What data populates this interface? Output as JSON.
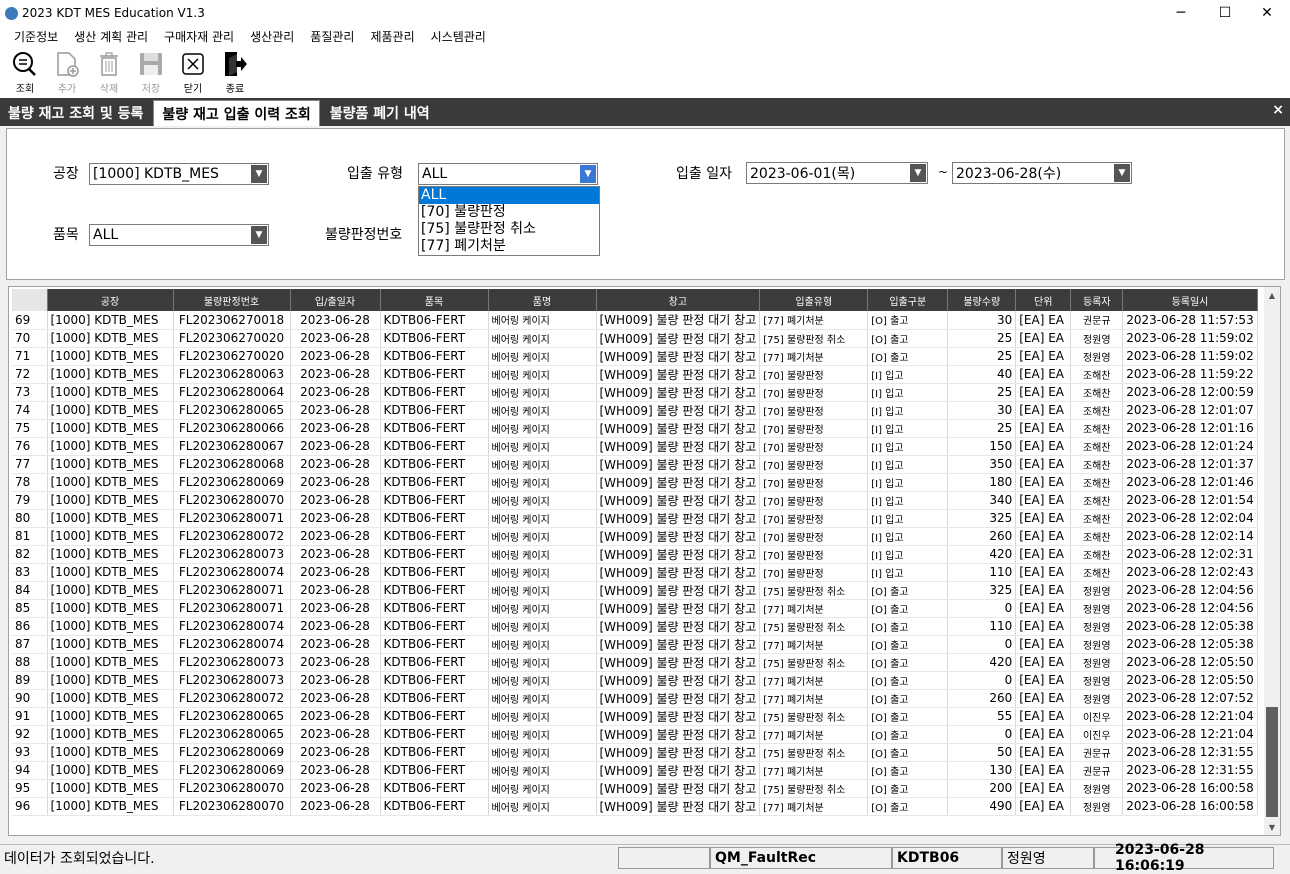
{
  "window": {
    "title": "2023 KDT MES Education V1.3",
    "minimize": "─",
    "maximize": "☐",
    "close": "✕"
  },
  "menu": [
    "기준정보",
    "생산 계획 관리",
    "구매자재 관리",
    "생산관리",
    "품질관리",
    "제품관리",
    "시스템관리"
  ],
  "toolbar": {
    "search": "조회",
    "add": "추가",
    "delete": "삭제",
    "save": "저장",
    "close": "닫기",
    "exit": "종료"
  },
  "tabs": [
    "불량 재고 조회 및 등록",
    "불량 재고 입출 이력 조회",
    "불량품 폐기 내역"
  ],
  "tab_close": "×",
  "filter": {
    "plant_label": "공장",
    "plant_value": "[1000] KDTB_MES",
    "type_label": "입출 유형",
    "type_value": "ALL",
    "date_label": "입출 일자",
    "date_from": "2023-06-01(목)",
    "date_sep": "~",
    "date_to": "2023-06-28(수)",
    "item_label": "품목",
    "item_value": "ALL",
    "judge_label": "불량판정번호",
    "dropdown_options": [
      "ALL",
      "[70] 불량판정",
      "[75] 불량판정 취소",
      "[77] 폐기처분"
    ]
  },
  "grid": {
    "columns": [
      "공장",
      "불량판정번호",
      "입/출일자",
      "품목",
      "품명",
      "창고",
      "입출유형",
      "입출구분",
      "불량수량",
      "단위",
      "등록자",
      "등록일시"
    ],
    "rows": [
      [
        "69",
        "[1000] KDTB_MES",
        "FL202306270018",
        "2023-06-28",
        "KDTB06-FERT",
        "베어링 케이지",
        "[WH009] 불량 판정 대기 창고",
        "[77] 폐기처분",
        "[O] 출고",
        "30",
        "[EA] EA",
        "권문규",
        "2023-06-28 11:57:53"
      ],
      [
        "70",
        "[1000] KDTB_MES",
        "FL202306270020",
        "2023-06-28",
        "KDTB06-FERT",
        "베어링 케이지",
        "[WH009] 불량 판정 대기 창고",
        "[75] 불량판정 취소",
        "[O] 출고",
        "25",
        "[EA] EA",
        "정원영",
        "2023-06-28 11:59:02"
      ],
      [
        "71",
        "[1000] KDTB_MES",
        "FL202306270020",
        "2023-06-28",
        "KDTB06-FERT",
        "베어링 케이지",
        "[WH009] 불량 판정 대기 창고",
        "[77] 폐기처분",
        "[O] 출고",
        "25",
        "[EA] EA",
        "정원영",
        "2023-06-28 11:59:02"
      ],
      [
        "72",
        "[1000] KDTB_MES",
        "FL202306280063",
        "2023-06-28",
        "KDTB06-FERT",
        "베어링 케이지",
        "[WH009] 불량 판정 대기 창고",
        "[70] 불량판정",
        "[I] 입고",
        "40",
        "[EA] EA",
        "조해찬",
        "2023-06-28 11:59:22"
      ],
      [
        "73",
        "[1000] KDTB_MES",
        "FL202306280064",
        "2023-06-28",
        "KDTB06-FERT",
        "베어링 케이지",
        "[WH009] 불량 판정 대기 창고",
        "[70] 불량판정",
        "[I] 입고",
        "25",
        "[EA] EA",
        "조해찬",
        "2023-06-28 12:00:59"
      ],
      [
        "74",
        "[1000] KDTB_MES",
        "FL202306280065",
        "2023-06-28",
        "KDTB06-FERT",
        "베어링 케이지",
        "[WH009] 불량 판정 대기 창고",
        "[70] 불량판정",
        "[I] 입고",
        "30",
        "[EA] EA",
        "조해찬",
        "2023-06-28 12:01:07"
      ],
      [
        "75",
        "[1000] KDTB_MES",
        "FL202306280066",
        "2023-06-28",
        "KDTB06-FERT",
        "베어링 케이지",
        "[WH009] 불량 판정 대기 창고",
        "[70] 불량판정",
        "[I] 입고",
        "25",
        "[EA] EA",
        "조해찬",
        "2023-06-28 12:01:16"
      ],
      [
        "76",
        "[1000] KDTB_MES",
        "FL202306280067",
        "2023-06-28",
        "KDTB06-FERT",
        "베어링 케이지",
        "[WH009] 불량 판정 대기 창고",
        "[70] 불량판정",
        "[I] 입고",
        "150",
        "[EA] EA",
        "조해찬",
        "2023-06-28 12:01:24"
      ],
      [
        "77",
        "[1000] KDTB_MES",
        "FL202306280068",
        "2023-06-28",
        "KDTB06-FERT",
        "베어링 케이지",
        "[WH009] 불량 판정 대기 창고",
        "[70] 불량판정",
        "[I] 입고",
        "350",
        "[EA] EA",
        "조해찬",
        "2023-06-28 12:01:37"
      ],
      [
        "78",
        "[1000] KDTB_MES",
        "FL202306280069",
        "2023-06-28",
        "KDTB06-FERT",
        "베어링 케이지",
        "[WH009] 불량 판정 대기 창고",
        "[70] 불량판정",
        "[I] 입고",
        "180",
        "[EA] EA",
        "조해찬",
        "2023-06-28 12:01:46"
      ],
      [
        "79",
        "[1000] KDTB_MES",
        "FL202306280070",
        "2023-06-28",
        "KDTB06-FERT",
        "베어링 케이지",
        "[WH009] 불량 판정 대기 창고",
        "[70] 불량판정",
        "[I] 입고",
        "340",
        "[EA] EA",
        "조해찬",
        "2023-06-28 12:01:54"
      ],
      [
        "80",
        "[1000] KDTB_MES",
        "FL202306280071",
        "2023-06-28",
        "KDTB06-FERT",
        "베어링 케이지",
        "[WH009] 불량 판정 대기 창고",
        "[70] 불량판정",
        "[I] 입고",
        "325",
        "[EA] EA",
        "조해찬",
        "2023-06-28 12:02:04"
      ],
      [
        "81",
        "[1000] KDTB_MES",
        "FL202306280072",
        "2023-06-28",
        "KDTB06-FERT",
        "베어링 케이지",
        "[WH009] 불량 판정 대기 창고",
        "[70] 불량판정",
        "[I] 입고",
        "260",
        "[EA] EA",
        "조해찬",
        "2023-06-28 12:02:14"
      ],
      [
        "82",
        "[1000] KDTB_MES",
        "FL202306280073",
        "2023-06-28",
        "KDTB06-FERT",
        "베어링 케이지",
        "[WH009] 불량 판정 대기 창고",
        "[70] 불량판정",
        "[I] 입고",
        "420",
        "[EA] EA",
        "조해찬",
        "2023-06-28 12:02:31"
      ],
      [
        "83",
        "[1000] KDTB_MES",
        "FL202306280074",
        "2023-06-28",
        "KDTB06-FERT",
        "베어링 케이지",
        "[WH009] 불량 판정 대기 창고",
        "[70] 불량판정",
        "[I] 입고",
        "110",
        "[EA] EA",
        "조해찬",
        "2023-06-28 12:02:43"
      ],
      [
        "84",
        "[1000] KDTB_MES",
        "FL202306280071",
        "2023-06-28",
        "KDTB06-FERT",
        "베어링 케이지",
        "[WH009] 불량 판정 대기 창고",
        "[75] 불량판정 취소",
        "[O] 출고",
        "325",
        "[EA] EA",
        "정원영",
        "2023-06-28 12:04:56"
      ],
      [
        "85",
        "[1000] KDTB_MES",
        "FL202306280071",
        "2023-06-28",
        "KDTB06-FERT",
        "베어링 케이지",
        "[WH009] 불량 판정 대기 창고",
        "[77] 폐기처분",
        "[O] 출고",
        "0",
        "[EA] EA",
        "정원영",
        "2023-06-28 12:04:56"
      ],
      [
        "86",
        "[1000] KDTB_MES",
        "FL202306280074",
        "2023-06-28",
        "KDTB06-FERT",
        "베어링 케이지",
        "[WH009] 불량 판정 대기 창고",
        "[75] 불량판정 취소",
        "[O] 출고",
        "110",
        "[EA] EA",
        "정원영",
        "2023-06-28 12:05:38"
      ],
      [
        "87",
        "[1000] KDTB_MES",
        "FL202306280074",
        "2023-06-28",
        "KDTB06-FERT",
        "베어링 케이지",
        "[WH009] 불량 판정 대기 창고",
        "[77] 폐기처분",
        "[O] 출고",
        "0",
        "[EA] EA",
        "정원영",
        "2023-06-28 12:05:38"
      ],
      [
        "88",
        "[1000] KDTB_MES",
        "FL202306280073",
        "2023-06-28",
        "KDTB06-FERT",
        "베어링 케이지",
        "[WH009] 불량 판정 대기 창고",
        "[75] 불량판정 취소",
        "[O] 출고",
        "420",
        "[EA] EA",
        "정원영",
        "2023-06-28 12:05:50"
      ],
      [
        "89",
        "[1000] KDTB_MES",
        "FL202306280073",
        "2023-06-28",
        "KDTB06-FERT",
        "베어링 케이지",
        "[WH009] 불량 판정 대기 창고",
        "[77] 폐기처분",
        "[O] 출고",
        "0",
        "[EA] EA",
        "정원영",
        "2023-06-28 12:05:50"
      ],
      [
        "90",
        "[1000] KDTB_MES",
        "FL202306280072",
        "2023-06-28",
        "KDTB06-FERT",
        "베어링 케이지",
        "[WH009] 불량 판정 대기 창고",
        "[77] 폐기처분",
        "[O] 출고",
        "260",
        "[EA] EA",
        "정원영",
        "2023-06-28 12:07:52"
      ],
      [
        "91",
        "[1000] KDTB_MES",
        "FL202306280065",
        "2023-06-28",
        "KDTB06-FERT",
        "베어링 케이지",
        "[WH009] 불량 판정 대기 창고",
        "[75] 불량판정 취소",
        "[O] 출고",
        "55",
        "[EA] EA",
        "이진우",
        "2023-06-28 12:21:04"
      ],
      [
        "92",
        "[1000] KDTB_MES",
        "FL202306280065",
        "2023-06-28",
        "KDTB06-FERT",
        "베어링 케이지",
        "[WH009] 불량 판정 대기 창고",
        "[77] 폐기처분",
        "[O] 출고",
        "0",
        "[EA] EA",
        "이진우",
        "2023-06-28 12:21:04"
      ],
      [
        "93",
        "[1000] KDTB_MES",
        "FL202306280069",
        "2023-06-28",
        "KDTB06-FERT",
        "베어링 케이지",
        "[WH009] 불량 판정 대기 창고",
        "[75] 불량판정 취소",
        "[O] 출고",
        "50",
        "[EA] EA",
        "권문규",
        "2023-06-28 12:31:55"
      ],
      [
        "94",
        "[1000] KDTB_MES",
        "FL202306280069",
        "2023-06-28",
        "KDTB06-FERT",
        "베어링 케이지",
        "[WH009] 불량 판정 대기 창고",
        "[77] 폐기처분",
        "[O] 출고",
        "130",
        "[EA] EA",
        "권문규",
        "2023-06-28 12:31:55"
      ],
      [
        "95",
        "[1000] KDTB_MES",
        "FL202306280070",
        "2023-06-28",
        "KDTB06-FERT",
        "베어링 케이지",
        "[WH009] 불량 판정 대기 창고",
        "[75] 불량판정 취소",
        "[O] 출고",
        "200",
        "[EA] EA",
        "정원영",
        "2023-06-28 16:00:58"
      ],
      [
        "96",
        "[1000] KDTB_MES",
        "FL202306280070",
        "2023-06-28",
        "KDTB06-FERT",
        "베어링 케이지",
        "[WH009] 불량 판정 대기 창고",
        "[77] 폐기처분",
        "[O] 출고",
        "490",
        "[EA] EA",
        "정원영",
        "2023-06-28 16:00:58"
      ]
    ]
  },
  "status": {
    "message": "데이터가 조회되었습니다.",
    "form": "QM_FaultRec",
    "company": "KDTB06",
    "user": "정원영",
    "datetime": "2023-06-28 16:06:19"
  },
  "colors": {
    "tabbar": "#3a3a3a",
    "header": "#3c3c3c",
    "selection": "#0078d7"
  }
}
